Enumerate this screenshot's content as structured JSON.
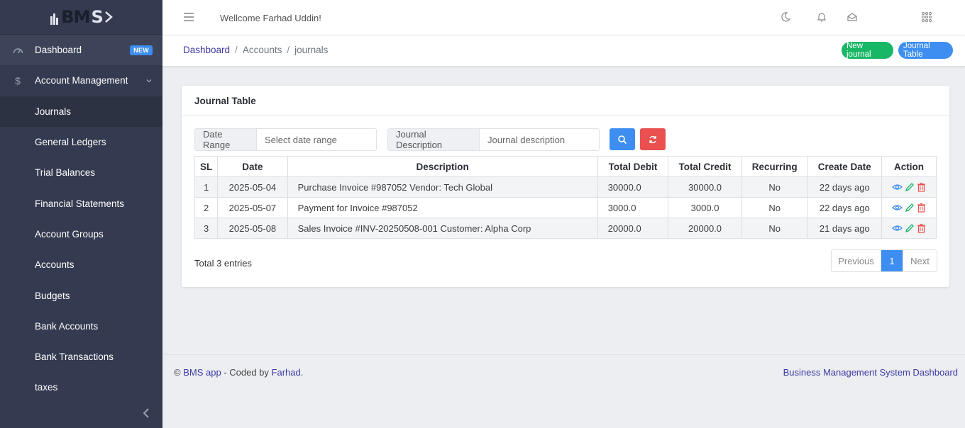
{
  "logo": {
    "text_left": "BM",
    "text_right": "S"
  },
  "sidebar": {
    "items": [
      {
        "label": "Dashboard",
        "badge": "NEW",
        "icon": "speedometer-icon"
      },
      {
        "label": "Account Management",
        "icon": "dollar-icon"
      },
      {
        "label": "Journals"
      },
      {
        "label": "General Ledgers"
      },
      {
        "label": "Trial Balances"
      },
      {
        "label": "Financial Statements"
      },
      {
        "label": "Account Groups"
      },
      {
        "label": "Accounts"
      },
      {
        "label": "Budgets"
      },
      {
        "label": "Bank Accounts"
      },
      {
        "label": "Bank Transactions"
      },
      {
        "label": "taxes"
      }
    ]
  },
  "header": {
    "welcome": "Wellcome Farhad Uddin!"
  },
  "breadcrumb": {
    "items": [
      "Dashboard",
      "Accounts",
      "journals"
    ]
  },
  "actions": {
    "new_journal": "New journal",
    "journal_table": "Journal Table"
  },
  "card": {
    "title": "Journal Table",
    "filters": {
      "date_label": "Date Range",
      "date_placeholder": "Select date range",
      "desc_label": "Journal Description",
      "desc_placeholder": "Journal description"
    },
    "table": {
      "headers": [
        "SL",
        "Date",
        "Description",
        "Total Debit",
        "Total Credit",
        "Recurring",
        "Create Date",
        "Action"
      ],
      "rows": [
        [
          "1",
          "2025-05-04",
          "Purchase Invoice #987052 Vendor: Tech Global",
          "30000.0",
          "30000.0",
          "No",
          "22 days ago"
        ],
        [
          "2",
          "2025-05-07",
          "Payment for Invoice #987052",
          "3000.0",
          "3000.0",
          "No",
          "22 days ago"
        ],
        [
          "3",
          "2025-05-08",
          "Sales Invoice #INV-20250508-001 Customer: Alpha Corp",
          "20000.0",
          "20000.0",
          "No",
          "21 days ago"
        ]
      ]
    },
    "total": "Total 3 entries",
    "pagination": {
      "prev": "Previous",
      "current": "1",
      "next": "Next"
    }
  },
  "footer": {
    "copy": "©",
    "app_link": "BMS app",
    "coded_by": " - Coded by ",
    "author": "Farhad",
    "dot": ".",
    "right": "Business Management System Dashboard"
  },
  "colors": {
    "sidebar": "#343a4f",
    "primary": "#3d8ef0",
    "success": "#17b765",
    "danger": "#e9504f",
    "link": "#3d3aa5"
  }
}
